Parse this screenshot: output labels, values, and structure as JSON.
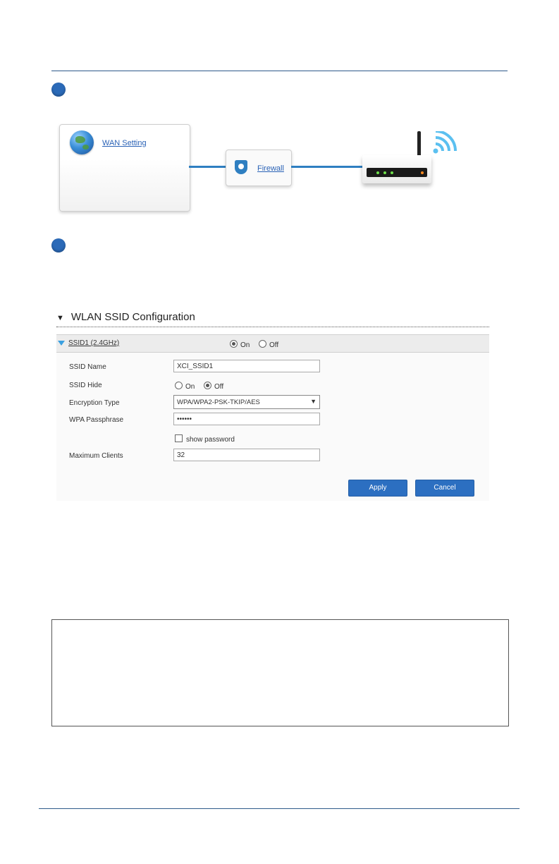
{
  "diagram": {
    "wan_link": "WAN Setting",
    "firewall_link": "Firewall",
    "icons": [
      "globe-icon",
      "shield-icon",
      "router-icon",
      "wifi-icon"
    ]
  },
  "wlan": {
    "section_title": "WLAN SSID Configuration",
    "ssid1": {
      "label": "SSID1 (2.4GHz)",
      "status_on": "On",
      "status_off": "Off"
    },
    "fields": {
      "ssid_name_label": "SSID Name",
      "ssid_name_value": "XCI_SSID1",
      "ssid_hide_label": "SSID Hide",
      "hide_on": "On",
      "hide_off": "Off",
      "encryption_label": "Encryption Type",
      "encryption_value": "WPA/WPA2-PSK-TKIP/AES",
      "passphrase_label": "WPA Passphrase",
      "passphrase_value": "••••••",
      "show_password_label": "show password",
      "max_clients_label": "Maximum Clients",
      "max_clients_value": "32"
    },
    "buttons": {
      "apply": "Apply",
      "cancel": "Cancel"
    }
  },
  "colors": {
    "accent": "#2c6fc1",
    "rule": "#2e5a8a",
    "link_line": "#2f7fc1",
    "wifi": "#5bc0f0"
  }
}
